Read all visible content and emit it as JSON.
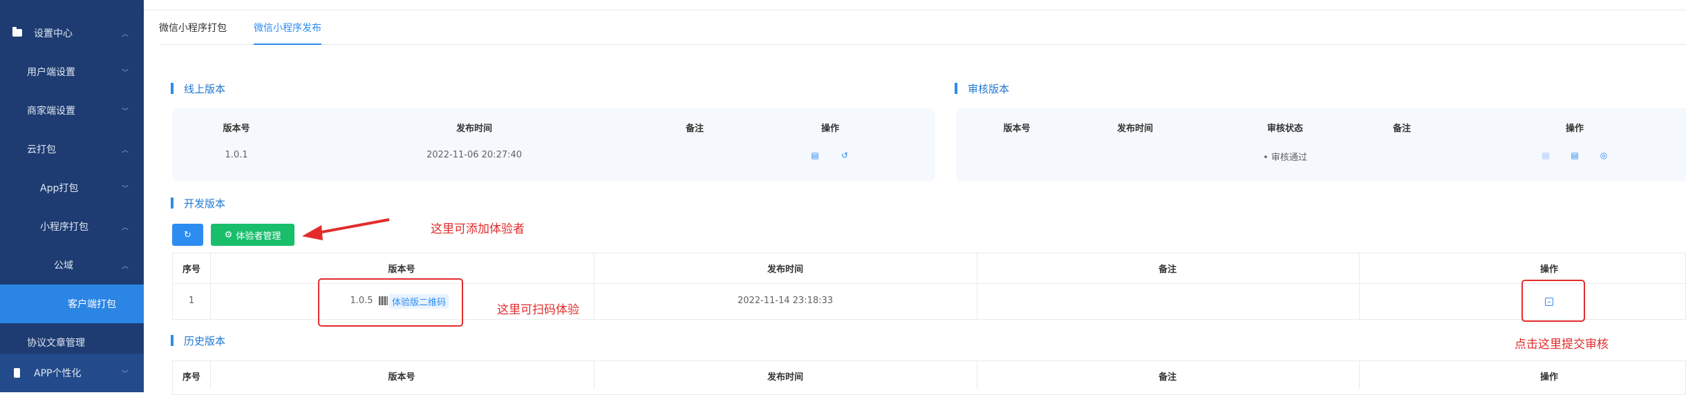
{
  "sidebar": {
    "items": [
      {
        "label": "设置中心",
        "chevron": "up"
      },
      {
        "label": "用户端设置",
        "chevron": "down"
      },
      {
        "label": "商家端设置",
        "chevron": "down"
      },
      {
        "label": "云打包",
        "chevron": "up"
      },
      {
        "label": "App打包",
        "chevron": "down"
      },
      {
        "label": "小程序打包",
        "chevron": "up"
      },
      {
        "label": "公域",
        "chevron": "up"
      },
      {
        "label": "客户端打包",
        "active": true
      },
      {
        "label": "协议文章管理"
      },
      {
        "label": "APP个性化",
        "chevron": "down"
      }
    ]
  },
  "tabs": [
    {
      "label": "微信小程序打包"
    },
    {
      "label": "微信小程序发布",
      "active": true
    }
  ],
  "online": {
    "title": "线上版本",
    "headers": [
      "版本号",
      "发布时间",
      "备注",
      "操作"
    ],
    "row": {
      "version": "1.0.1",
      "time": "2022-11-06 20:27:40",
      "note": ""
    }
  },
  "review": {
    "title": "审核版本",
    "headers": [
      "版本号",
      "发布时间",
      "审核状态",
      "备注",
      "操作"
    ],
    "row": {
      "status": "• 审核通过"
    }
  },
  "dev": {
    "title": "开发版本",
    "manage_label": "体验者管理",
    "headers": [
      "序号",
      "版本号",
      "发布时间",
      "备注",
      "操作"
    ],
    "row": {
      "index": "1",
      "version": "1.0.5",
      "qr_label": "体验版二维码",
      "time": "2022-11-14 23:18:33",
      "note": ""
    }
  },
  "history": {
    "title": "历史版本",
    "headers": [
      "序号",
      "版本号",
      "发布时间",
      "备注",
      "操作"
    ]
  },
  "annotations": {
    "add_tester": "这里可添加体验者",
    "scan": "这里可扫码体验",
    "submit": "点击这里提交审核"
  },
  "colors": {
    "sidebar_bg": "#1e3c72",
    "accent": "#2d8cf0",
    "success": "#19be6b",
    "annotation": "#e32b2b"
  }
}
